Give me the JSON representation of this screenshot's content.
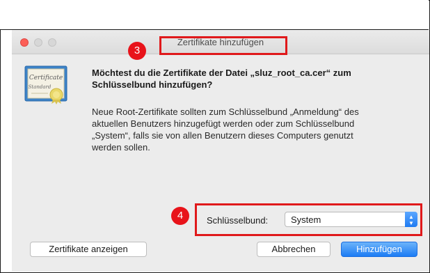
{
  "window": {
    "title": "Zertifikate hinzufügen"
  },
  "annotations": {
    "step_title": "3",
    "step_keychain": "4",
    "highlight_color": "#e0191b"
  },
  "dialog": {
    "headline_line1": "Möchtest du die Zertifikate der Datei „sluz_root_ca.cer“ zum",
    "headline_line2": "Schlüsselbund hinzufügen?",
    "body_line1": "Neue Root-Zertifikate sollten zum Schlüsselbund „Anmeldung“ des",
    "body_line2": "aktuellen Benutzers hinzugefügt werden oder zum Schlüsselbund",
    "body_line3": "„System“, falls sie von allen Benutzern dieses Computers genutzt",
    "body_line4": "werden sollen.",
    "certificate_icon": "certificate-icon",
    "certificate_word": "Certificate",
    "standard_word": "Standard"
  },
  "keychain": {
    "label": "Schlüsselbund:",
    "selected": "System"
  },
  "buttons": {
    "show_certificates": "Zertifikate anzeigen",
    "cancel": "Abbrechen",
    "add": "Hinzufügen"
  },
  "colors": {
    "accent": "#1c7cf4",
    "close": "#fc5f57",
    "badge": "#e8131a"
  }
}
